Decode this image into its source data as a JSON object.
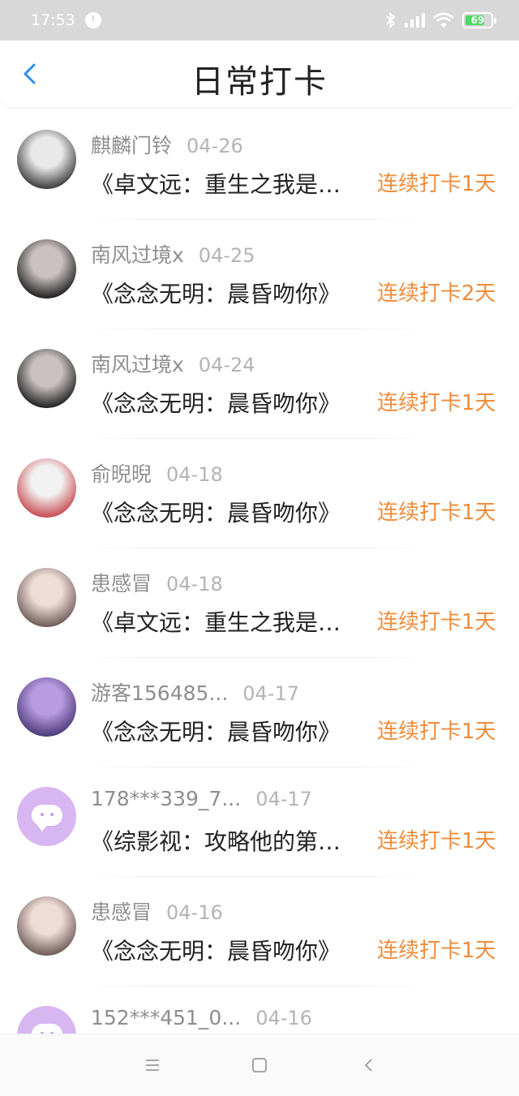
{
  "status_bar": {
    "time": "17:53",
    "battery": "69",
    "battery_level": 0.69
  },
  "header": {
    "title": "日常打卡"
  },
  "checkins": [
    {
      "name": "麒麟门铃",
      "date": "04-26",
      "book": "《卓文远：重生之我是…",
      "streak": "连续打卡1天",
      "avatar": "photo",
      "avatar_colors": [
        "#e9e9e9",
        "#3a3a3a"
      ]
    },
    {
      "name": "南风过境x",
      "date": "04-25",
      "book": "《念念无明：晨昏吻你》",
      "streak": "连续打卡2天",
      "avatar": "photo",
      "avatar_colors": [
        "#c9c2c0",
        "#1e1e1e"
      ]
    },
    {
      "name": "南风过境x",
      "date": "04-24",
      "book": "《念念无明：晨昏吻你》",
      "streak": "连续打卡1天",
      "avatar": "photo",
      "avatar_colors": [
        "#c9c2c0",
        "#1e1e1e"
      ]
    },
    {
      "name": "俞晲晲",
      "date": "04-18",
      "book": "《念念无明：晨昏吻你》",
      "streak": "连续打卡1天",
      "avatar": "photo",
      "avatar_colors": [
        "#f2f2f2",
        "#c7494e"
      ]
    },
    {
      "name": "患感冒",
      "date": "04-18",
      "book": "《卓文远：重生之我是…",
      "streak": "连续打卡1天",
      "avatar": "photo",
      "avatar_colors": [
        "#efdcd6",
        "#6b5a57"
      ]
    },
    {
      "name": "游客156485...",
      "date": "04-17",
      "book": "《念念无明：晨昏吻你》",
      "streak": "连续打卡1天",
      "avatar": "photo",
      "avatar_colors": [
        "#b89be0",
        "#4b3a78"
      ]
    },
    {
      "name": "178***339_7...",
      "date": "04-17",
      "book": "《综影视：攻略他的第…",
      "streak": "连续打卡1天",
      "avatar": "default",
      "avatar_colors": [
        "#d7b6f2",
        "#ffffff"
      ]
    },
    {
      "name": "患感冒",
      "date": "04-16",
      "book": "《念念无明：晨昏吻你》",
      "streak": "连续打卡1天",
      "avatar": "photo",
      "avatar_colors": [
        "#efdcd6",
        "#6b5a57"
      ]
    },
    {
      "name": "152***451_0...",
      "date": "04-16",
      "book": "",
      "streak": "",
      "avatar": "default",
      "avatar_colors": [
        "#d7b6f2",
        "#ffffff"
      ]
    }
  ],
  "icons": {
    "back": "chevron-left-icon",
    "nav_menu": "menu-icon",
    "nav_home": "home-square-icon",
    "nav_back": "back-triangle-icon"
  },
  "colors": {
    "accent": "#2b8ff0",
    "streak": "#f08c3b"
  }
}
